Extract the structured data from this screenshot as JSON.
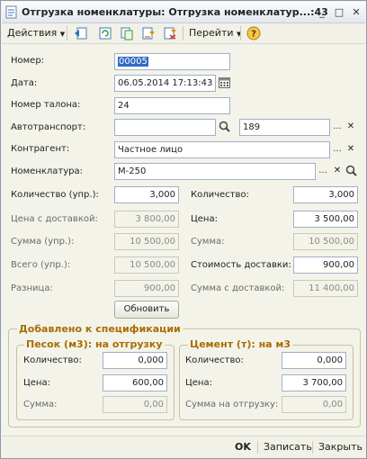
{
  "window": {
    "title": "Отгрузка номенклатуры: Отгрузка номенклатур...:43",
    "controls": {
      "minimize": "_",
      "maximize": "□",
      "close": "✕"
    }
  },
  "toolbar": {
    "actions_label": "Действия",
    "goto_label": "Перейти",
    "help_label": "?"
  },
  "form": {
    "number": {
      "label": "Номер:",
      "value": "00005"
    },
    "date": {
      "label": "Дата:",
      "value": "06.05.2014 17:13:43"
    },
    "ticket": {
      "label": "Номер талона:",
      "value": "24"
    },
    "vehicle": {
      "label": "Автотранспорт:",
      "value": "",
      "value2": "189"
    },
    "contractor": {
      "label": "Контрагент:",
      "value": "Частное лицо"
    },
    "nomenclature": {
      "label": "Номенклатура:",
      "value": "М-250"
    },
    "qty_upr": {
      "label": "Количество (упр.):",
      "value": "3,000"
    },
    "qty": {
      "label": "Количество:",
      "value": "3,000"
    },
    "price_delivery": {
      "label": "Цена с доставкой:",
      "value": "3 800,00"
    },
    "price": {
      "label": "Цена:",
      "value": "3 500,00"
    },
    "sum_upr": {
      "label": "Сумма (упр.):",
      "value": "10 500,00"
    },
    "sum": {
      "label": "Сумма:",
      "value": "10 500,00"
    },
    "total_upr": {
      "label": "Всего (упр.):",
      "value": "10 500,00"
    },
    "delivery_cost": {
      "label": "Стоимость доставки:",
      "value": "900,00"
    },
    "diff": {
      "label": "Разница:",
      "value": "900,00"
    },
    "sum_delivery": {
      "label": "Сумма с доставкой:",
      "value": "11 400,00"
    },
    "refresh_label": "Обновить"
  },
  "spec": {
    "title": "Добавлено к спецификации",
    "sand": {
      "title": "Песок (м3): на отгрузку",
      "qty": {
        "label": "Количество:",
        "value": "0,000"
      },
      "price": {
        "label": "Цена:",
        "value": "600,00"
      },
      "sum": {
        "label": "Сумма:",
        "value": "0,00"
      }
    },
    "cement": {
      "title": "Цемент (т): на м3",
      "qty": {
        "label": "Количество:",
        "value": "0,000"
      },
      "price": {
        "label": "Цена:",
        "value": "3 700,00"
      },
      "sum": {
        "label": "Сумма на отгрузку:",
        "value": "0,00"
      }
    }
  },
  "footer": {
    "ok_label": "OK",
    "save_label": "Записать",
    "close_label": "Закрыть"
  },
  "icons": {
    "app": "document-icon",
    "prev": "prev-record-icon",
    "refresh": "refresh-icon",
    "copy": "copy-icon",
    "post": "post-document-icon",
    "unpost": "unpost-document-icon",
    "calendar": "calendar-icon",
    "search": "search-icon",
    "select": "select-icon",
    "clear": "clear-icon"
  }
}
